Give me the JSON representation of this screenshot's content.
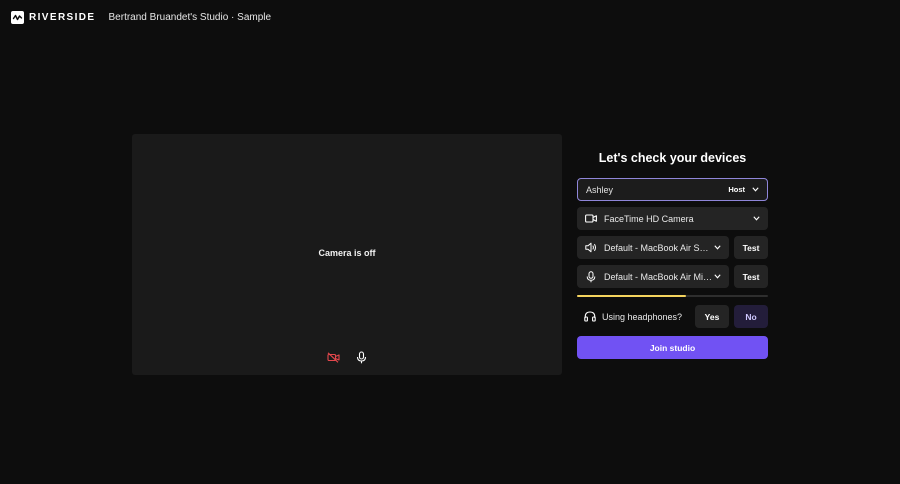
{
  "header": {
    "brand": "RIVERSIDE",
    "studio_title": "Bertrand Bruandet's Studio · Sample"
  },
  "preview": {
    "camera_status": "Camera is off",
    "camera_toggle_icon": "camera-off-icon",
    "mic_toggle_icon": "microphone-icon"
  },
  "panel": {
    "title": "Let's check your devices",
    "name_value": "Ashley",
    "role_label": "Host",
    "camera_device": "FaceTime HD Camera",
    "speaker_device": "Default - MacBook Air Speakers",
    "mic_device": "Default - MacBook Air Microphone",
    "test_label": "Test",
    "mic_level_percent": 57,
    "headphones_question": "Using headphones?",
    "yes_label": "Yes",
    "no_label": "No",
    "join_label": "Join studio"
  },
  "colors": {
    "background": "#0d0d0d",
    "accent": "#7152f3",
    "level_meter": "#f4d35e",
    "camera_off_icon": "#e5484d"
  }
}
